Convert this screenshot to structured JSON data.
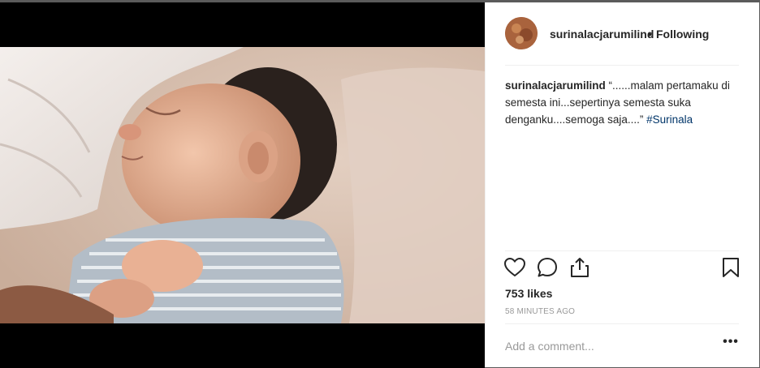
{
  "post": {
    "image_alt": "sleeping newborn baby",
    "author": "surinalacjarumilind",
    "separator": "•",
    "follow_state": "Following",
    "caption": {
      "username": "surinalacjarumilind",
      "text": " “......malam pertamaku di semesta ini...sepertinya semesta suka denganku....semoga saja....” ",
      "hashtag": "#Surinala"
    },
    "actions": {
      "like_icon": "heart-icon",
      "comment_icon": "comment-bubble-icon",
      "share_icon": "share-icon",
      "save_icon": "bookmark-icon"
    },
    "likes": "753 likes",
    "timestamp": "58 MINUTES AGO",
    "comment_placeholder": "Add a comment...",
    "more_label": "•••"
  },
  "colors": {
    "hashtag": "#003569",
    "muted": "#999999",
    "text": "#262626"
  }
}
